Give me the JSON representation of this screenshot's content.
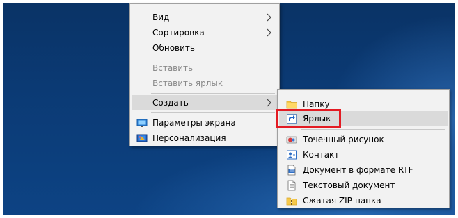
{
  "context_menu": {
    "items": [
      {
        "label": "Вид",
        "has_submenu": true
      },
      {
        "label": "Сортировка",
        "has_submenu": true
      },
      {
        "label": "Обновить"
      },
      {
        "label": "Вставить",
        "disabled": true
      },
      {
        "label": "Вставить ярлык",
        "disabled": true
      },
      {
        "label": "Создать",
        "has_submenu": true,
        "hover": true
      },
      {
        "label": "Параметры экрана",
        "icon": "display-settings-icon"
      },
      {
        "label": "Персонализация",
        "icon": "personalization-icon"
      }
    ]
  },
  "create_submenu": {
    "items": [
      {
        "label": "Папку",
        "icon": "folder-icon"
      },
      {
        "label": "Ярлык",
        "icon": "shortcut-icon",
        "hover": true,
        "highlighted": true
      },
      {
        "label": "Точечный рисунок",
        "icon": "bitmap-icon"
      },
      {
        "label": "Контакт",
        "icon": "contact-icon"
      },
      {
        "label": "Документ в формате RTF",
        "icon": "rtf-document-icon"
      },
      {
        "label": "Текстовый документ",
        "icon": "text-document-icon"
      },
      {
        "label": "Сжатая ZIP-папка",
        "icon": "zip-folder-icon"
      }
    ]
  },
  "colors": {
    "highlight_border": "#e31b23",
    "menu_background": "#f2f2f2",
    "hover_background": "#dadada",
    "disabled_text": "#8a8a8a"
  }
}
